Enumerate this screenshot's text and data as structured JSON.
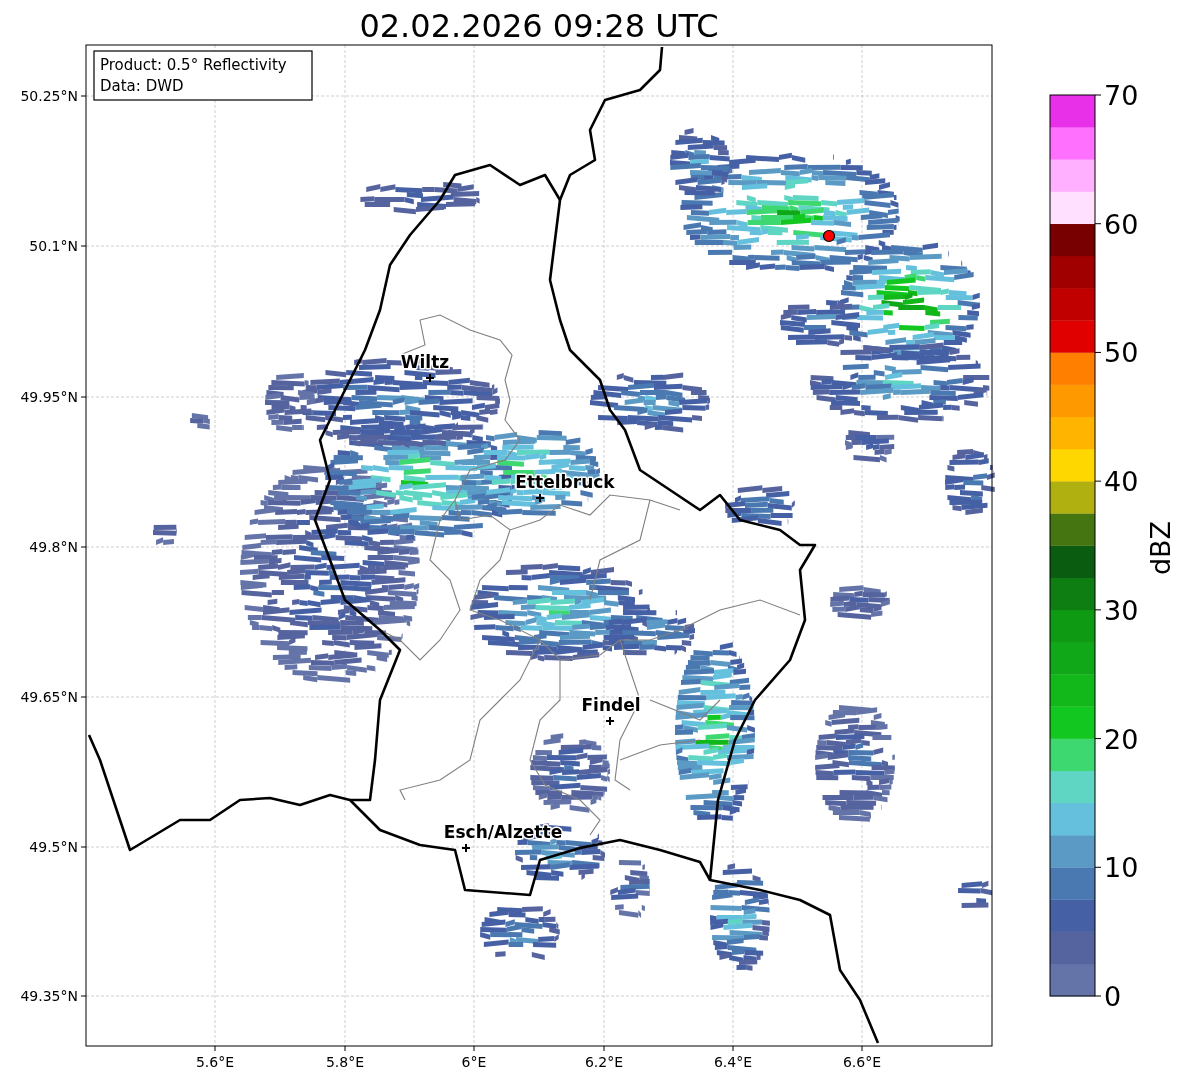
{
  "title": "02.02.2026 09:28 UTC",
  "info_box": {
    "product": "Product: 0.5° Reflectivity",
    "data": "Data: DWD"
  },
  "lat_ticks": [
    "50.25°N",
    "50.1°N",
    "49.95°N",
    "49.8°N",
    "49.65°N",
    "49.5°N",
    "49.35°N"
  ],
  "lon_ticks": [
    "5.6°E",
    "5.8°E",
    "6°E",
    "6.2°E",
    "6.4°E",
    "6.6°E"
  ],
  "cities": [
    {
      "name": "Wiltz"
    },
    {
      "name": "Ettelbruck"
    },
    {
      "name": "Findel"
    },
    {
      "name": "Esch/Alzette"
    }
  ],
  "colorbar": {
    "label": "dBZ",
    "ticks": [
      "70",
      "60",
      "50",
      "40",
      "30",
      "20",
      "10",
      "0"
    ],
    "bins": [
      {
        "color": "#6474a8"
      },
      {
        "color": "#55639f"
      },
      {
        "color": "#4560a4"
      },
      {
        "color": "#4a78b0"
      },
      {
        "color": "#5a9ac4"
      },
      {
        "color": "#64c0dc"
      },
      {
        "color": "#5fd6c4"
      },
      {
        "color": "#3dd870"
      },
      {
        "color": "#12c820"
      },
      {
        "color": "#12b81a"
      },
      {
        "color": "#10a818"
      },
      {
        "color": "#0f9a14"
      },
      {
        "color": "#0e7d12"
      },
      {
        "color": "#0a5c10"
      },
      {
        "color": "#457510"
      },
      {
        "color": "#b0b010"
      },
      {
        "color": "#ffd700"
      },
      {
        "color": "#ffb400"
      },
      {
        "color": "#ff9900"
      },
      {
        "color": "#ff7f00"
      },
      {
        "color": "#e00000"
      },
      {
        "color": "#c00000"
      },
      {
        "color": "#a00000"
      },
      {
        "color": "#780000"
      },
      {
        "color": "#ffe0ff"
      },
      {
        "color": "#ffb0ff"
      },
      {
        "color": "#ff70ff"
      },
      {
        "color": "#e830e8"
      }
    ]
  }
}
